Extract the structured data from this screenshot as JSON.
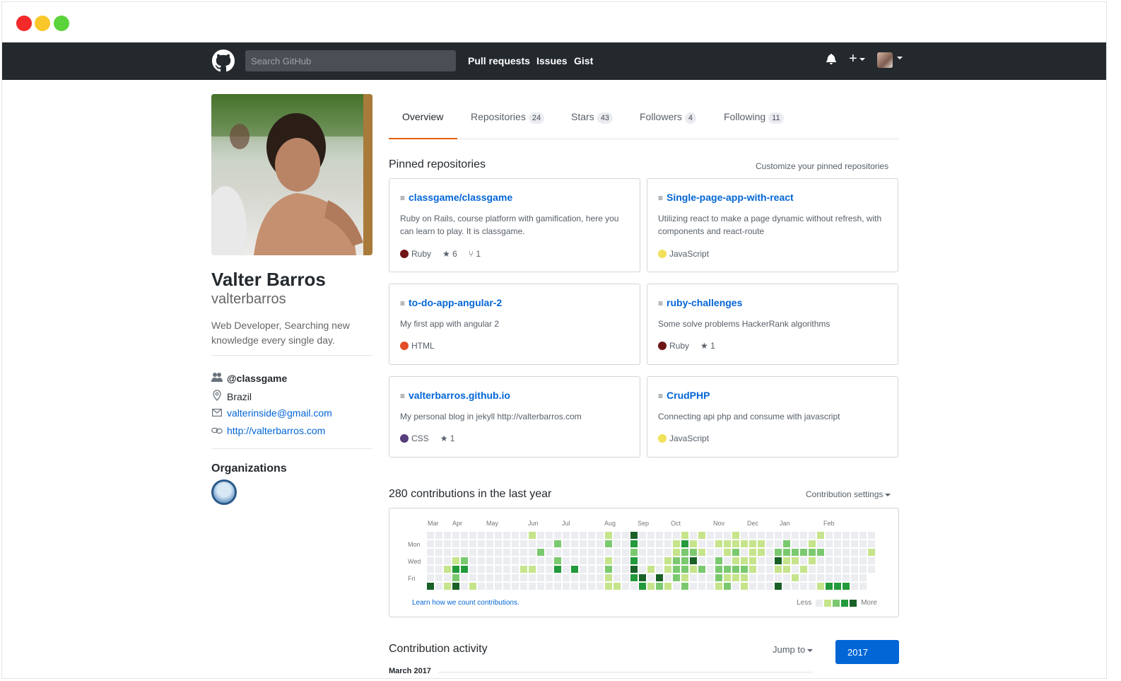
{
  "header": {
    "search_placeholder": "Search GitHub",
    "nav": [
      "Pull requests",
      "Issues",
      "Gist"
    ],
    "plus_label": "+"
  },
  "profile": {
    "name": "Valter Barros",
    "login": "valterbarros",
    "bio": "Web Developer, Searching new knowledge every single day.",
    "org": "@classgame",
    "location": "Brazil",
    "email": "valterinside@gmail.com",
    "website": "http://valterbarros.com",
    "organizations_title": "Organizations"
  },
  "tabs": [
    {
      "label": "Overview",
      "count": null
    },
    {
      "label": "Repositories",
      "count": "24"
    },
    {
      "label": "Stars",
      "count": "43"
    },
    {
      "label": "Followers",
      "count": "4"
    },
    {
      "label": "Following",
      "count": "11"
    }
  ],
  "pinned": {
    "title": "Pinned repositories",
    "customize": "Customize your pinned repositories",
    "repos": [
      {
        "name": "classgame/classgame",
        "desc": "Ruby on Rails, course platform with gamification, here you can learn to play. It is classgame.",
        "lang": "Ruby",
        "color": "#701516",
        "stars": "6",
        "forks": "1"
      },
      {
        "name": "Single-page-app-with-react",
        "desc": "Utilizing react to make a page dynamic without refresh, with components and react-route",
        "lang": "JavaScript",
        "color": "#f1e05a",
        "stars": "",
        "forks": ""
      },
      {
        "name": "to-do-app-angular-2",
        "desc": "My first app with angular 2",
        "lang": "HTML",
        "color": "#e34c26",
        "stars": "",
        "forks": ""
      },
      {
        "name": "ruby-challenges",
        "desc": "Some solve problems HackerRank algorithms",
        "lang": "Ruby",
        "color": "#701516",
        "stars": "1",
        "forks": ""
      },
      {
        "name": "valterbarros.github.io",
        "desc": "My personal blog in jekyll http://valterbarros.com",
        "lang": "CSS",
        "color": "#563d7c",
        "stars": "1",
        "forks": ""
      },
      {
        "name": "CrudPHP",
        "desc": "Connecting api php and consume with javascript",
        "lang": "JavaScript",
        "color": "#f1e05a",
        "stars": "",
        "forks": ""
      }
    ]
  },
  "contributions": {
    "title": "280 contributions in the last year",
    "settings": "Contribution settings",
    "months": [
      "Mar",
      "Apr",
      "May",
      "Jun",
      "Jul",
      "Aug",
      "Sep",
      "Oct",
      "Nov",
      "Dec",
      "Jan",
      "Feb"
    ],
    "days": [
      "Mon",
      "Wed",
      "Fri"
    ],
    "learn": "Learn how we count contributions.",
    "less": "Less",
    "more": "More",
    "colors": [
      "#ebedf0",
      "#c6e48b",
      "#7bc96f",
      "#239a3b",
      "#196127"
    ]
  },
  "activity": {
    "title": "Contribution activity",
    "jump": "Jump to",
    "year": "2017",
    "month": "March 2017"
  }
}
